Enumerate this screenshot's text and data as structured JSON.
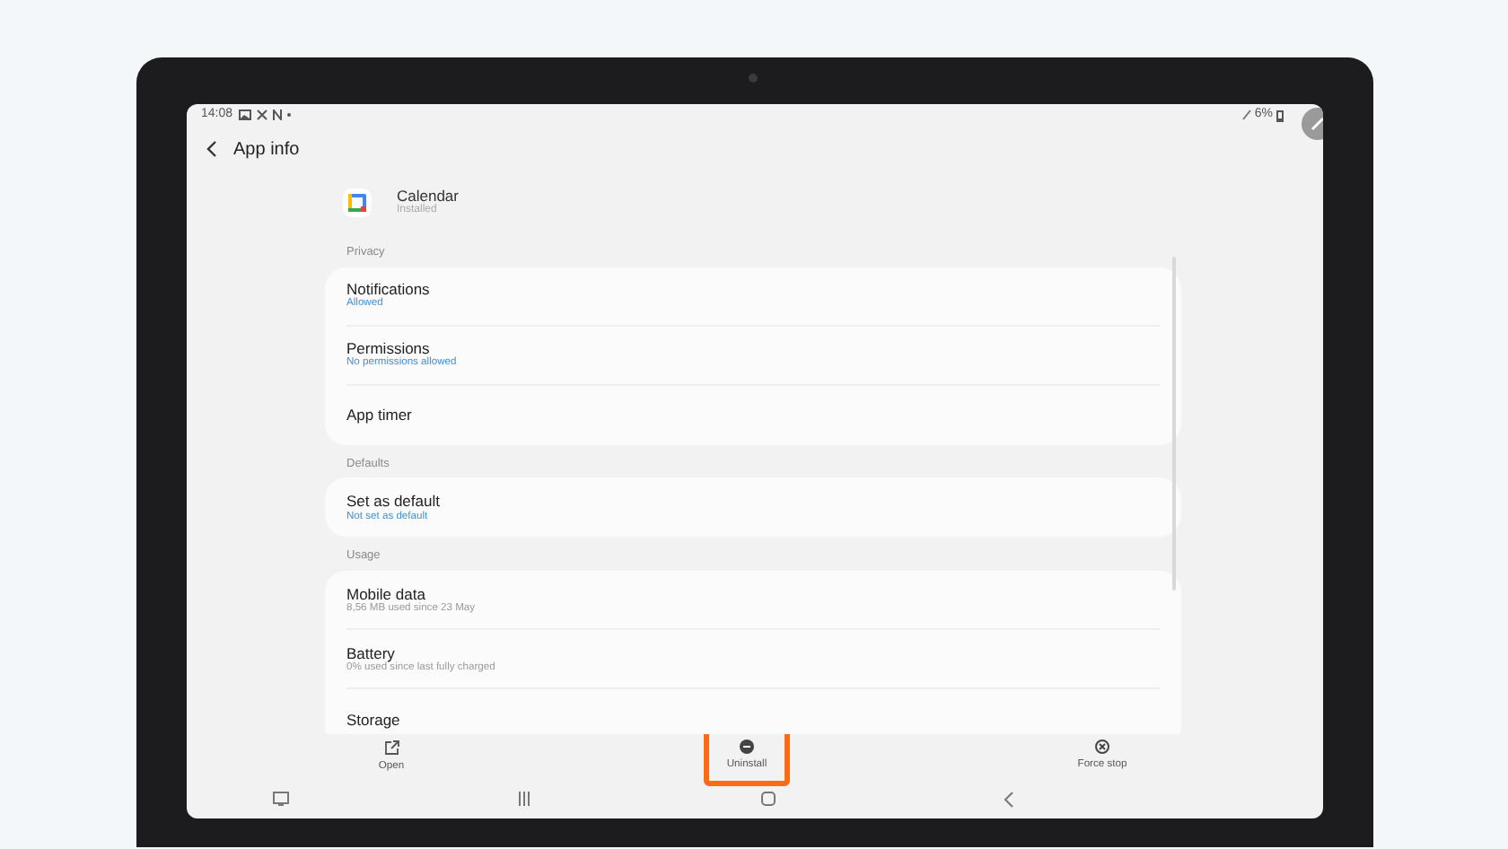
{
  "status_bar": {
    "time": "14:08",
    "battery": "6%"
  },
  "header": {
    "title": "App info"
  },
  "app": {
    "name": "Calendar",
    "status": "Installed"
  },
  "sections": [
    {
      "title": "Privacy",
      "items": [
        {
          "title": "Notifications",
          "subtitle": "Allowed",
          "kind": "link"
        },
        {
          "title": "Permissions",
          "subtitle": "No permissions allowed",
          "kind": "link"
        },
        {
          "title": "App timer"
        }
      ]
    },
    {
      "title": "Defaults",
      "items": [
        {
          "title": "Set as default",
          "subtitle": "Not set as default",
          "kind": "link"
        }
      ]
    },
    {
      "title": "Usage",
      "items": [
        {
          "title": "Mobile data",
          "subtitle": "8,56 MB used since 23 May",
          "kind": "info"
        },
        {
          "title": "Battery",
          "subtitle": "0% used since last fully charged",
          "kind": "info"
        },
        {
          "title": "Storage"
        }
      ]
    }
  ],
  "actions": [
    {
      "label": "Open",
      "kind": "open",
      "highlighted": false
    },
    {
      "label": "Uninstall",
      "kind": "uninstall",
      "highlighted": true
    },
    {
      "label": "Force stop",
      "kind": "stop",
      "highlighted": false
    }
  ]
}
